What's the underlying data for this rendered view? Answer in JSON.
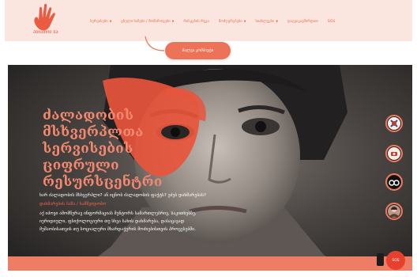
{
  "header": {
    "logo_text": "ასიათის ბაია",
    "nav": [
      {
        "label": "სერვისები",
        "dropdown": true
      },
      {
        "label": "ცხელი ხაზები / მომართვები",
        "dropdown": true
      },
      {
        "label": "რისკების რუკა",
        "dropdown": false
      },
      {
        "label": "მოძღვრებები",
        "dropdown": true
      },
      {
        "label": "სიახლეები",
        "dropdown": true
      },
      {
        "label": "დაგვიკავშირდით",
        "dropdown": false
      },
      {
        "label": "SOS",
        "dropdown": false
      }
    ]
  },
  "cta": {
    "label": "მალვა კომპიუტი"
  },
  "hero": {
    "title_line1": "ძალადობის მსხვერპლთა",
    "title_line2": "სერვისების ციფრული",
    "title_line3": "რესურსცენტრი",
    "question": "ხარ ძალადობის მსხვერპლი? ან იცნობ ძალადობის ფაქტს? ეძებ დახმარებას?",
    "link": "დახმარების ბაზა / სამშვიდობო",
    "desc_line1": "აქ იპოვი ამომწურავ ინფორმაციას მენტორს სამართლებრივ, საკითხებზე,",
    "desc_line2": "იურიდიული, ფსიქოლოგიური თუ სხვა სახის დახმარება, დასაცავად",
    "desc_line3": "მუშაობისათვის თუ სოციალური მხარდაჭერის მოძიებისთვის პროცესებში."
  },
  "side_icons": [
    "emergency-police-icon",
    "radio-icon",
    "binoculars-icon",
    "portrait-icon"
  ],
  "help_button": {
    "label": "SOS"
  },
  "colors": {
    "accent": "#ec7358",
    "nav": "#e66a52",
    "header_bg": "#fbe6df",
    "sos": "#e8402f"
  }
}
